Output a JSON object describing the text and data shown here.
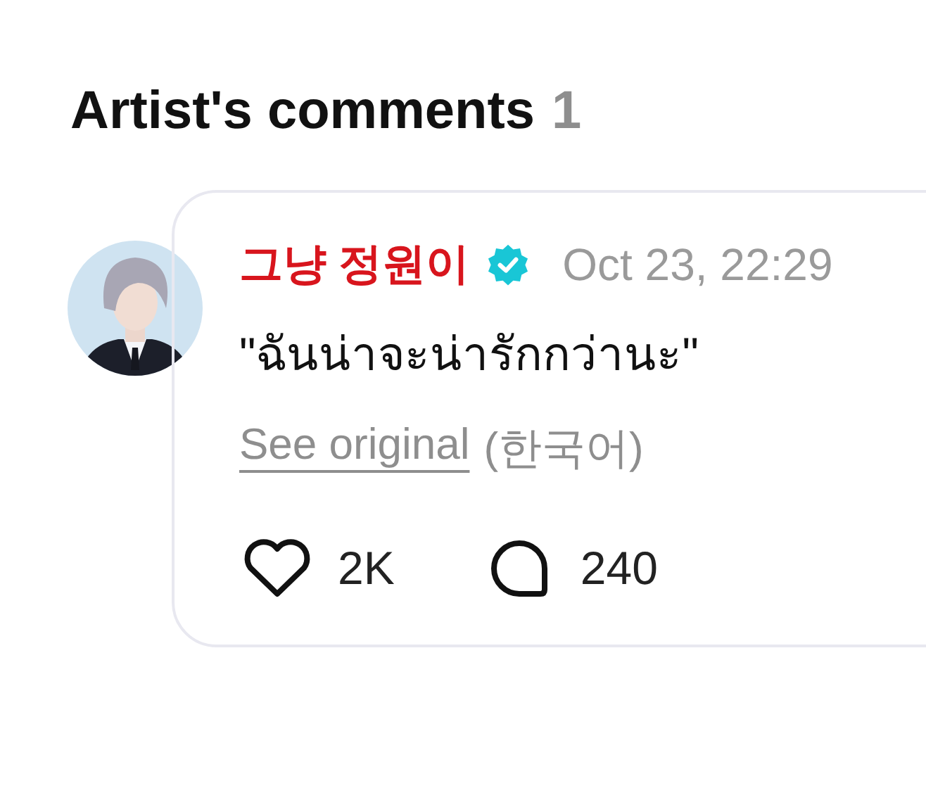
{
  "section": {
    "title": "Artist's comments",
    "count": "1"
  },
  "comments": [
    {
      "author": "그냥 정원이",
      "verified": true,
      "date": "Oct 23, 22:29",
      "text": "\"ฉันน่าจะน่ารักกว่านะ\"",
      "see_original": "See original",
      "language": "(한국어)",
      "likes": "2K",
      "replies": "240"
    }
  ]
}
